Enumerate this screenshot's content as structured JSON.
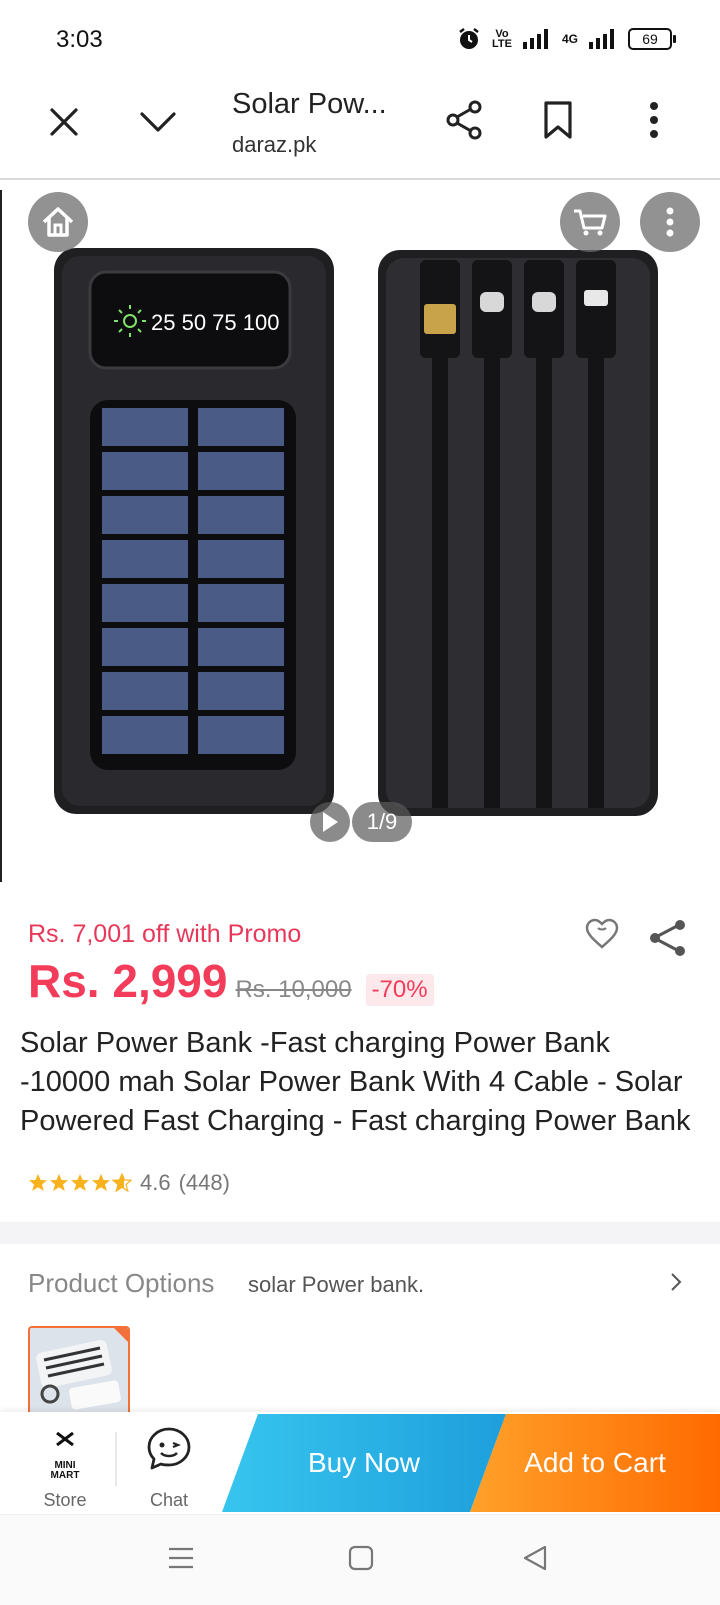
{
  "status_bar": {
    "time": "3:03",
    "volte_top": "Vo",
    "volte_bottom": "LTE",
    "network": "4G",
    "battery": "69"
  },
  "toolbar": {
    "title": "Solar Pow...",
    "url": "daraz.pk"
  },
  "gallery": {
    "lcd_text": "25 50 75 100",
    "pager": "1/9"
  },
  "product": {
    "promo": "Rs. 7,001 off with Promo",
    "price": "Rs. 2,999",
    "original_price": "Rs. 10,000",
    "discount": "-70%",
    "title": "Solar Power Bank -Fast charging Power Bank -10000 mah Solar Power Bank With 4 Cable - Solar Powered Fast Charging - Fast charging Power Bank",
    "rating": "4.6",
    "reviews": "(448)",
    "star_value": 4.6
  },
  "options": {
    "label": "Product Options",
    "value": "solar Power bank."
  },
  "action_bar": {
    "store_logo_top": "MINI",
    "store_logo_bottom": "MART",
    "store_label": "Store",
    "chat_label": "Chat",
    "buy_now": "Buy Now",
    "add_to_cart": "Add to Cart"
  },
  "colors": {
    "accent_red": "#f23c5a",
    "buy_blue": "#1e9fdc",
    "cart_orange": "#ff6a00"
  }
}
